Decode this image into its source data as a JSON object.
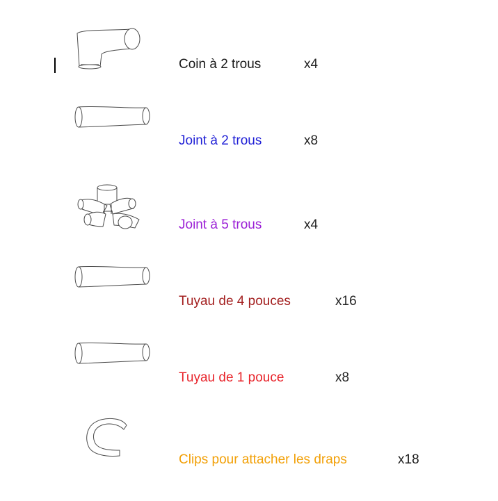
{
  "parts": [
    {
      "label": "Coin à 2 trous",
      "qty": "x4",
      "color": "#1a1a1a",
      "icon": "corner-pipe-icon"
    },
    {
      "label": "Joint à 2 trous",
      "qty": "x8",
      "color": "#1f1fd6",
      "icon": "straight-joint-icon"
    },
    {
      "label": "Joint à 5 trous",
      "qty": "x4",
      "color": "#9b1fd6",
      "icon": "five-way-joint-icon"
    },
    {
      "label": "Tuyau de 4 pouces",
      "qty": "x16",
      "color": "#a31f1f",
      "icon": "pipe-4-inch-icon"
    },
    {
      "label": "Tuyau de 1 pouce",
      "qty": "x8",
      "color": "#e8242b",
      "icon": "pipe-1-inch-icon"
    },
    {
      "label": "Clips pour attacher les draps",
      "qty": "x18",
      "color": "#f2a007",
      "icon": "sheet-clip-icon"
    }
  ]
}
